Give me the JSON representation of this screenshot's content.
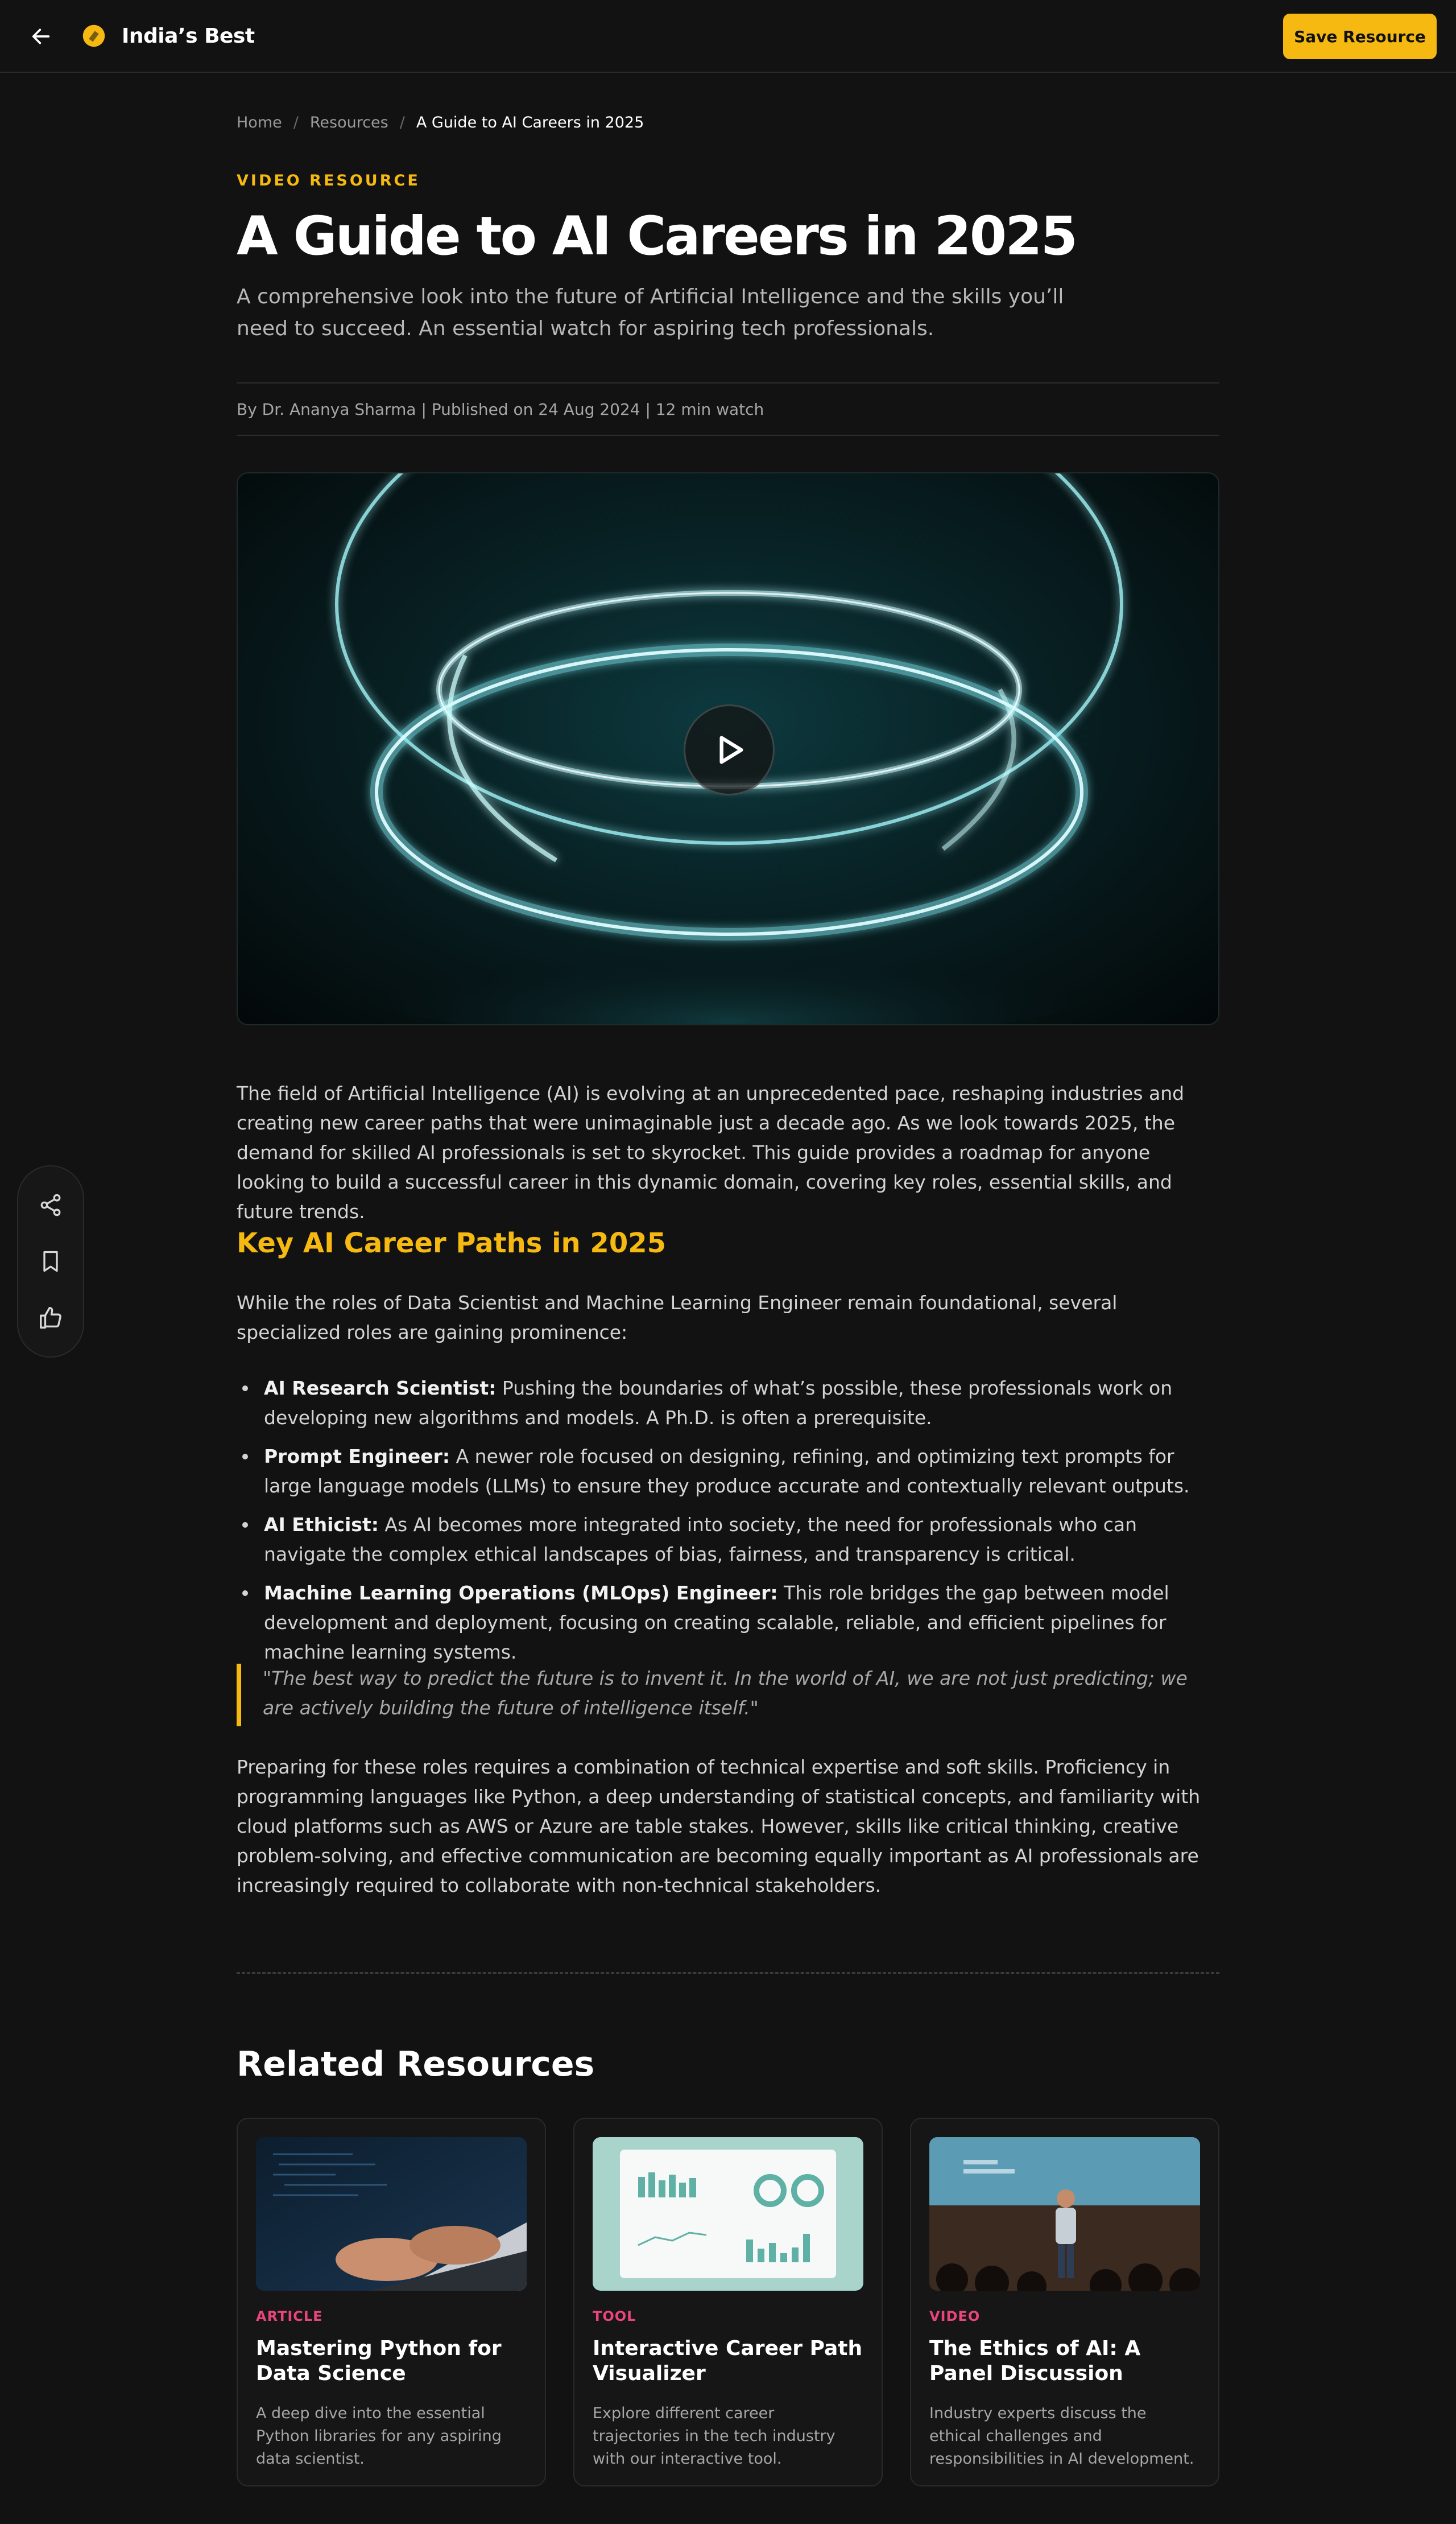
{
  "header": {
    "brand": "India’s Best",
    "save_label": "Save Resource"
  },
  "breadcrumb": {
    "home": "Home",
    "resources": "Resources",
    "current": "A Guide to AI Careers in 2025",
    "separator": "/"
  },
  "article": {
    "kicker": "VIDEO RESOURCE",
    "title": "A Guide to AI Careers in 2025",
    "subtitle": "A comprehensive look into the future of Artificial Intelligence and the skills you’ll need to succeed. An essential watch for aspiring tech professionals.",
    "meta": "By Dr. Ananya Sharma | Published on 24 Aug 2024 | 12 min watch",
    "intro": "The field of Artificial Intelligence (AI) is evolving at an unprecedented pace, reshaping industries and creating new career paths that were unimaginable just a decade ago. As we look towards 2025, the demand for skilled AI professionals is set to skyrocket. This guide provides a roadmap for anyone looking to build a successful career in this dynamic domain, covering key roles, essential skills, and future trends.",
    "section_heading": "Key AI Career Paths in 2025",
    "section_intro": "While the roles of Data Scientist and Machine Learning Engineer remain foundational, several specialized roles are gaining prominence:",
    "roles": [
      {
        "name": "AI Research Scientist:",
        "desc": " Pushing the boundaries of what’s possible, these professionals work on developing new algorithms and models. A Ph.D. is often a prerequisite."
      },
      {
        "name": "Prompt Engineer:",
        "desc": " A newer role focused on designing, refining, and optimizing text prompts for large language models (LLMs) to ensure they produce accurate and contextually relevant outputs."
      },
      {
        "name": "AI Ethicist:",
        "desc": " As AI becomes more integrated into society, the need for professionals who can navigate the complex ethical landscapes of bias, fairness, and transparency is critical."
      },
      {
        "name": "Machine Learning Operations (MLOps) Engineer:",
        "desc": " This role bridges the gap between model development and deployment, focusing on creating scalable, reliable, and efficient pipelines for machine learning systems."
      }
    ],
    "quote": "\"The best way to predict the future is to invent it. In the world of AI, we are not just predicting; we are actively building the future of intelligence itself.\"",
    "closing": "Preparing for these roles requires a combination of technical expertise and soft skills. Proficiency in programming languages like Python, a deep understanding of statistical concepts, and familiarity with cloud platforms such as AWS or Azure are table stakes. However, skills like critical thinking, creative problem-solving, and effective communication are becoming equally important as AI professionals are increasingly required to collaborate with non-technical stakeholders."
  },
  "related": {
    "heading": "Related Resources",
    "cards": [
      {
        "tag": "ARTICLE",
        "title": "Mastering Python for Data Science",
        "desc": "A deep dive into the essential Python libraries for any aspiring data scientist."
      },
      {
        "tag": "TOOL",
        "title": "Interactive Career Path Visualizer",
        "desc": "Explore different career trajectories in the tech industry with our interactive tool."
      },
      {
        "tag": "VIDEO",
        "title": "The Ethics of AI: A Panel Discussion",
        "desc": "Industry experts discuss the ethical challenges and responsibilities in AI development."
      }
    ]
  },
  "icons": {
    "back": "arrow-left-icon",
    "brand": "brand-logo-icon",
    "play": "play-icon",
    "share": "share-icon",
    "bookmark": "bookmark-icon",
    "like": "thumbs-up-icon"
  },
  "colors": {
    "accent": "#f5b912",
    "background": "#121212",
    "tag": "#e8457a"
  }
}
